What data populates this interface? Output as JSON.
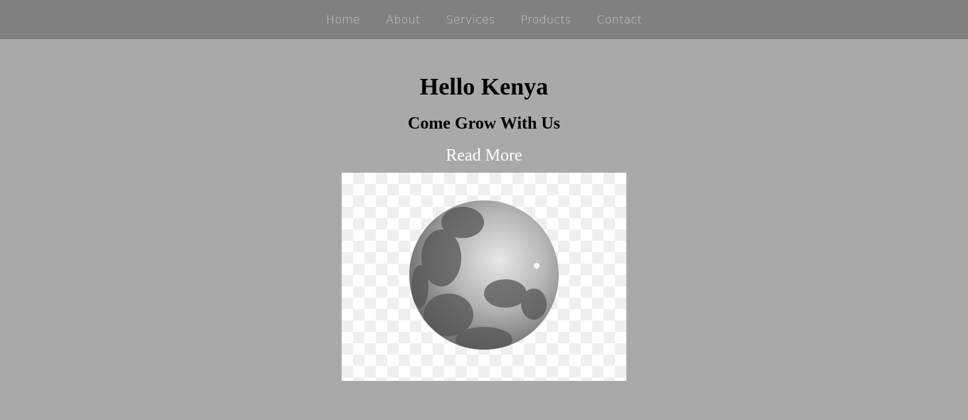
{
  "nav": {
    "items": [
      {
        "label": "Home"
      },
      {
        "label": "About"
      },
      {
        "label": "Services"
      },
      {
        "label": "Products"
      },
      {
        "label": "Contact"
      }
    ]
  },
  "hero": {
    "title": "Hello Kenya",
    "subtitle": "Come Grow With Us",
    "cta_label": "Read More",
    "image": "full-moon-image"
  },
  "colors": {
    "nav_bg": "#808080",
    "page_bg": "#a9a9a9",
    "cta_text": "#ffffff"
  }
}
